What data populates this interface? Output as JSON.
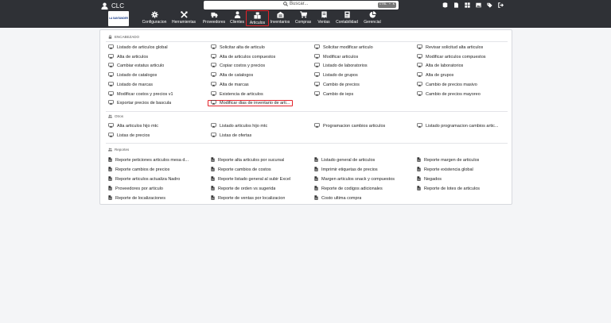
{
  "user": {
    "name": "CLC"
  },
  "search": {
    "placeholder": "Buscar...",
    "shortcut": "CTRL + K"
  },
  "logo_text": "LA SANTANDER",
  "topbar_icons": [
    "database-icon",
    "file-icon",
    "grid-icon",
    "image-icon",
    "tags-icon",
    "logout-icon"
  ],
  "menu": [
    {
      "label": "Configuracion",
      "icon": "gear-icon"
    },
    {
      "label": "Herramientas",
      "icon": "tools-icon"
    },
    {
      "label": "Proveedores",
      "icon": "truck-icon"
    },
    {
      "label": "Clientes",
      "icon": "users-icon"
    },
    {
      "label": "Articulos",
      "icon": "boxes-icon",
      "active": true
    },
    {
      "label": "Inventarios",
      "icon": "warehouse-icon"
    },
    {
      "label": "Compras",
      "icon": "cart-icon"
    },
    {
      "label": "Ventas",
      "icon": "receipt-icon"
    },
    {
      "label": "Contabilidad",
      "icon": "ledger-icon"
    },
    {
      "label": "Gerencial",
      "icon": "pie-chart-icon"
    }
  ],
  "sections": {
    "encabezado": {
      "title": "ENCABEZADO",
      "items": [
        "Listado de articulos global",
        "Solicitar alta de articulo",
        "Solicitar modificar articulo",
        "Revisar solicitud alta articulos",
        "Alta de articulos",
        "Alta de articulos compuestos",
        "Modificar articulos",
        "Modificar articulos compuestos",
        "Cambiar estatus articulo",
        "Copiar costos y precios",
        "Listado de laboratorios",
        "Alta de laboratorios",
        "Listado de catalogos",
        "Alta de catalogos",
        "Listado de grupos",
        "Alta de grupos",
        "Listado de marcas",
        "Alta de marcas",
        "Cambio de precios",
        "Cambio de precios masivo",
        "Modificar costos y precios v1",
        "Existencia de articulos",
        "Cambio de ieps",
        "Cambio de precios mayoreo",
        "Exportar precios de bascula",
        "Modificar dias de inventario de arti..."
      ]
    },
    "otros": {
      "title": "Otros",
      "items": [
        "Alta articulos hijo mtc",
        "Listado articulos hijo mtc",
        "Programacion cambios articulos",
        "Listado programacion cambios artic...",
        "Listas de precios",
        "Listas de ofertas"
      ]
    },
    "reportes": {
      "title": "Reportes",
      "items": [
        "Reporte peticiones articulos mesa d...",
        "Reporte alta articulos por sucursal",
        "Listado general de articulos",
        "Reporte margen de articulos",
        "Reporte cambios de precios",
        "Reporte cambios de costos",
        "Imprimir etiquetas de precios",
        "Reporte existencia global",
        "Reporte articulos actualiza Nadro",
        "Reporte listado general al subir Excel",
        "Margen articulos snack y compuestos",
        "Negados",
        "Proveedores por articulo",
        "Reporte de orden vs sugerida",
        "Reporte de codigos adicionales",
        "Reporte de lotes de articulos",
        "Reporte de localizaciones",
        "Reporte de ventas por localizacion",
        "Costo ultima compra"
      ]
    }
  },
  "colors": {
    "topbar": "#2f3136",
    "highlight": "#e3242b",
    "panel_border": "#d7d9de"
  }
}
